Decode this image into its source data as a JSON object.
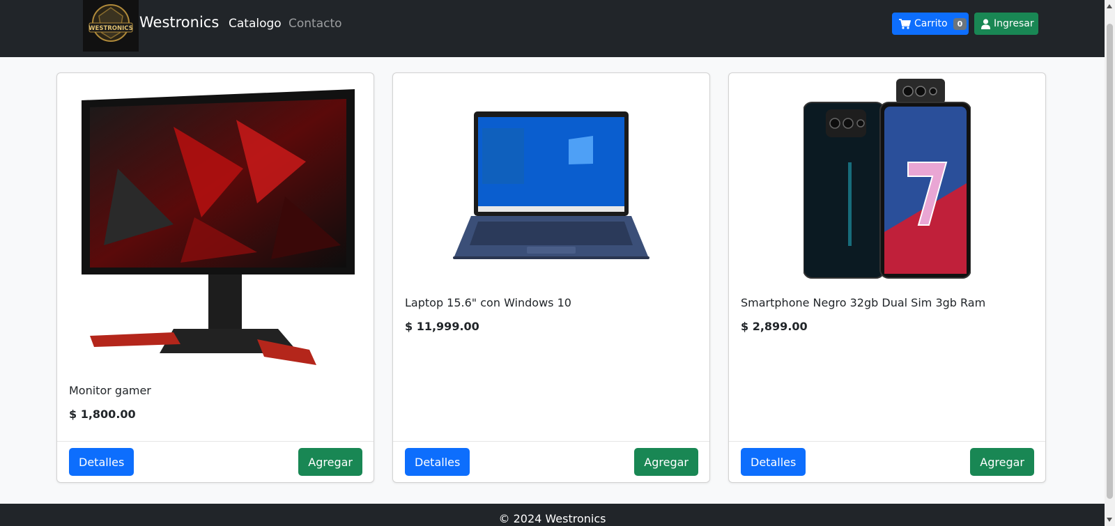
{
  "navbar": {
    "brand_logo_text": "WESTRONICS",
    "brand_name": "Westronics",
    "links": [
      {
        "label": "Catalogo"
      },
      {
        "label": "Contacto"
      }
    ],
    "cart_label": "Carrito",
    "cart_count": "0",
    "login_label": "Ingresar"
  },
  "products": [
    {
      "title": "Monitor gamer",
      "price": "$ 1,800.00",
      "details_label": "Detalles",
      "add_label": "Agregar"
    },
    {
      "title": "Laptop 15.6\" con Windows 10",
      "price": "$ 11,999.00",
      "details_label": "Detalles",
      "add_label": "Agregar"
    },
    {
      "title": "Smartphone Negro 32gb Dual Sim 3gb Ram",
      "price": "$ 2,899.00",
      "details_label": "Detalles",
      "add_label": "Agregar"
    }
  ],
  "footer": {
    "copyright": "© 2024 Westronics"
  },
  "colors": {
    "navbar_bg": "#212529",
    "primary": "#0d6efd",
    "success": "#198754"
  }
}
